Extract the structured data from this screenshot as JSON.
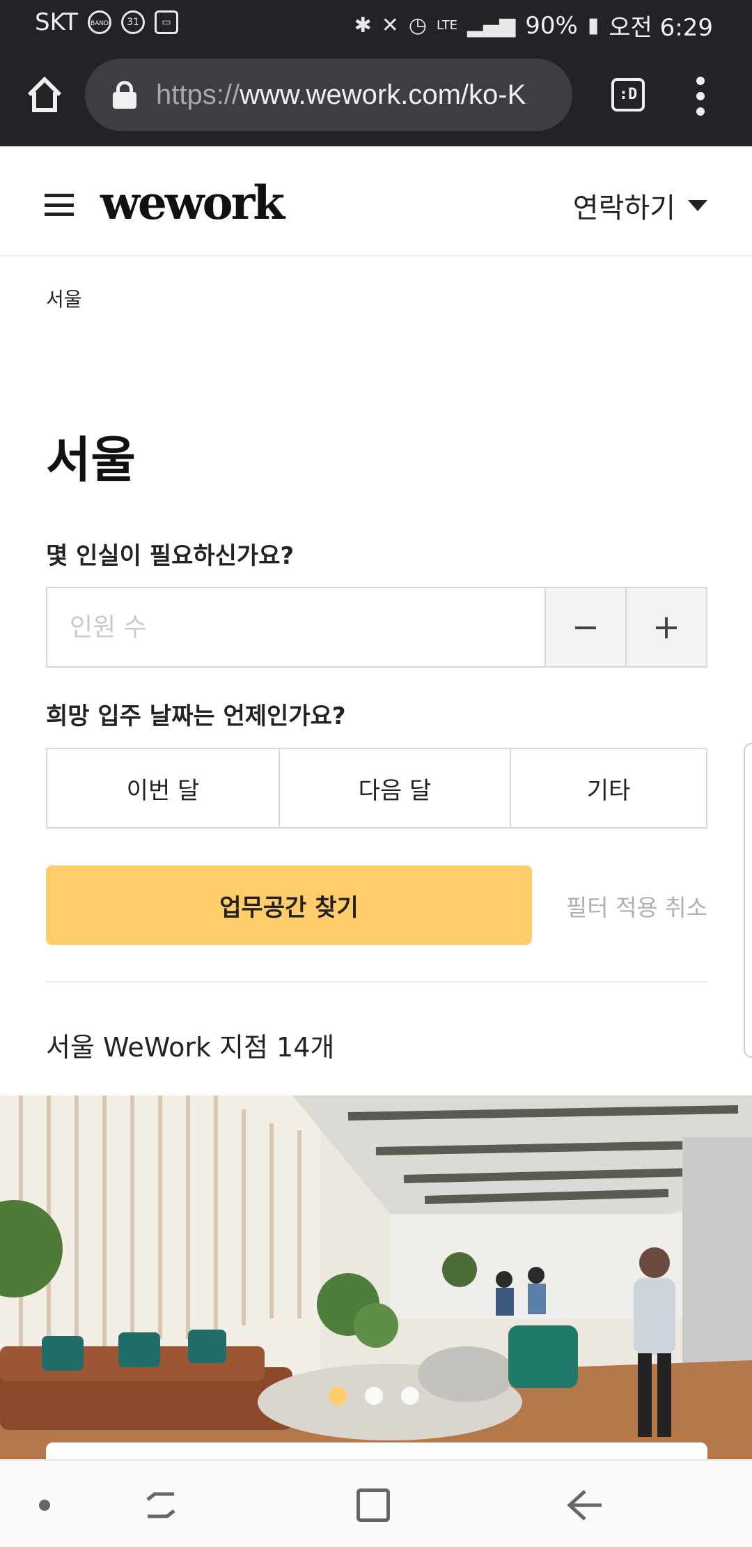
{
  "status_bar": {
    "carrier": "SKT",
    "notif_band": "BAND",
    "notif_calendar": "31",
    "network": "LTE",
    "battery": "90%",
    "time": "오전 6:29"
  },
  "browser": {
    "url_scheme": "https://",
    "url_host": "www.wework.com/ko-K",
    "tab_label": ":D"
  },
  "header": {
    "logo": "wework",
    "contact_label": "연락하기"
  },
  "breadcrumb": "서울",
  "title": "서울",
  "filters": {
    "people_question": "몇 인실이 필요하신가요?",
    "people_placeholder": "인원 수",
    "minus_label": "−",
    "plus_label": "+",
    "date_question": "희망 입주 날짜는 언제인가요?",
    "date_options": [
      "이번 달",
      "다음 달",
      "기타"
    ],
    "search_button": "업무공간 찾기",
    "reset_link": "필터 적용 취소"
  },
  "results": {
    "count_text": "서울 WeWork 지점 14개"
  },
  "carousel": {
    "slide_count": 3,
    "active_index": 0,
    "accent_color": "#ffcd69"
  },
  "colors": {
    "brand_yellow": "#ffcd69",
    "chrome_dark": "#222326"
  }
}
